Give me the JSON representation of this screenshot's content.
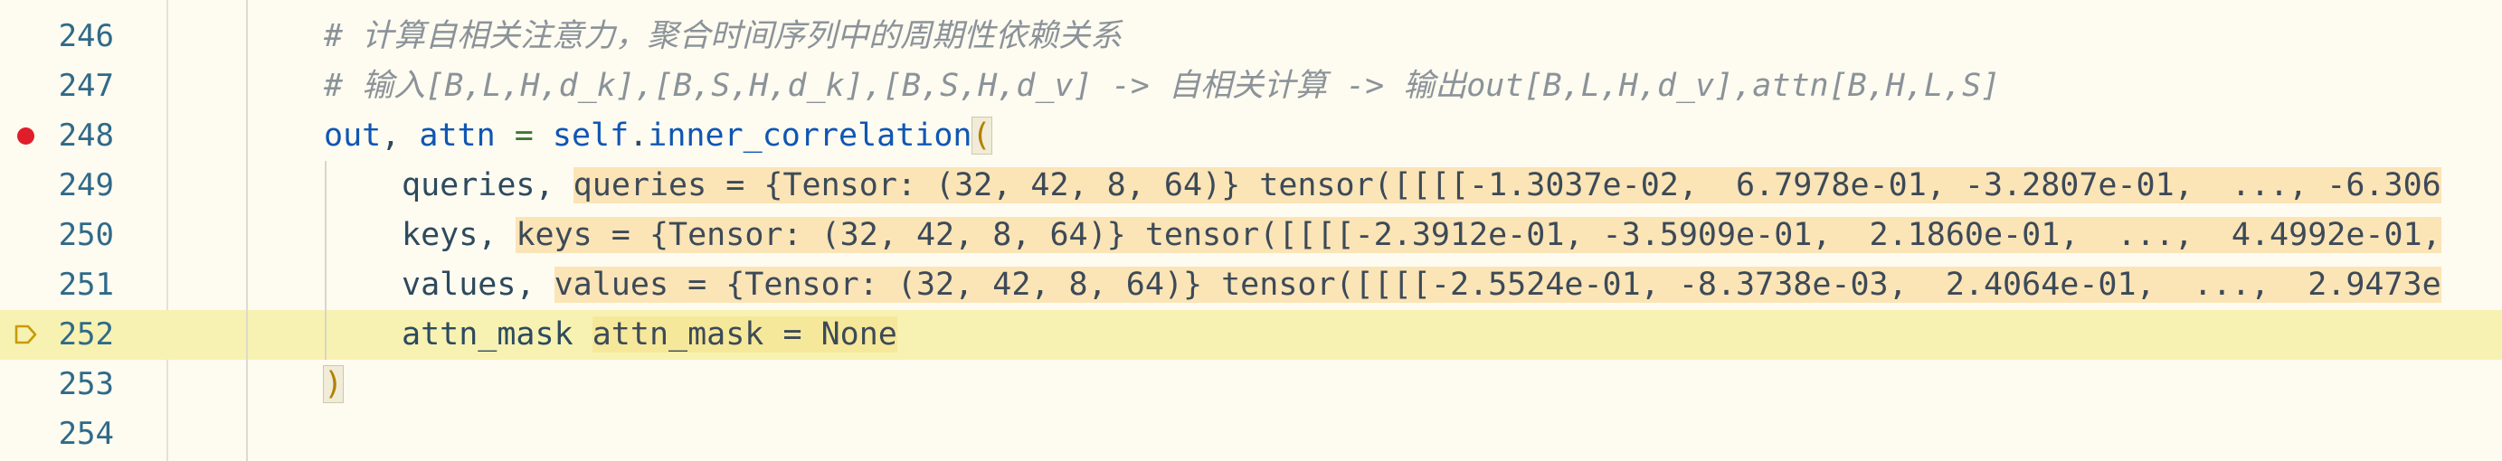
{
  "editor": {
    "lines": [
      {
        "number": "246",
        "comment": "# 计算自相关注意力，聚合时间序列中的周期性依赖关系"
      },
      {
        "number": "247",
        "comment": "# 输入[B,L,H,d_k],[B,S,H,d_k],[B,S,H,d_v] -> 自相关计算 -> 输出out[B,L,H,d_v],attn[B,H,L,S]"
      },
      {
        "number": "248",
        "lhs_out": "out",
        "comma": ",",
        "lhs_attn": "attn",
        "equals": "=",
        "self_kw": "self",
        "dot": ".",
        "method": "inner_correlation",
        "open_paren": "("
      },
      {
        "number": "249",
        "param": "queries",
        "comma": ",",
        "debug_value": "queries = {Tensor: (32, 42, 8, 64)} tensor([[[[-1.3037e-02,  6.7978e-01, -3.2807e-01,  ..., -6.306"
      },
      {
        "number": "250",
        "param": "keys",
        "comma": ",",
        "debug_value": "keys = {Tensor: (32, 42, 8, 64)} tensor([[[[-2.3912e-01, -3.5909e-01,  2.1860e-01,  ...,  4.4992e-01,"
      },
      {
        "number": "251",
        "param": "values",
        "comma": ",",
        "debug_value": "values = {Tensor: (32, 42, 8, 64)} tensor([[[[-2.5524e-01, -8.3738e-03,  2.4064e-01,  ...,  2.9473e"
      },
      {
        "number": "252",
        "param": "attn_mask",
        "debug_value": "attn_mask = None"
      },
      {
        "number": "253",
        "close_paren": ")"
      },
      {
        "number": "254"
      }
    ]
  },
  "colors": {
    "background": "#fefbf0",
    "current_line": "#f7f2b2",
    "breakpoint": "#e01e2b",
    "line_number": "#2f6a89",
    "comment": "#8b9399",
    "identifier": "#0f56b4",
    "inline_value_bg": "#fbe4b6"
  },
  "icons": {
    "breakpoint_line_248": "breakpoint-icon",
    "execution_marker_line_252": "execution-pointer-icon"
  }
}
